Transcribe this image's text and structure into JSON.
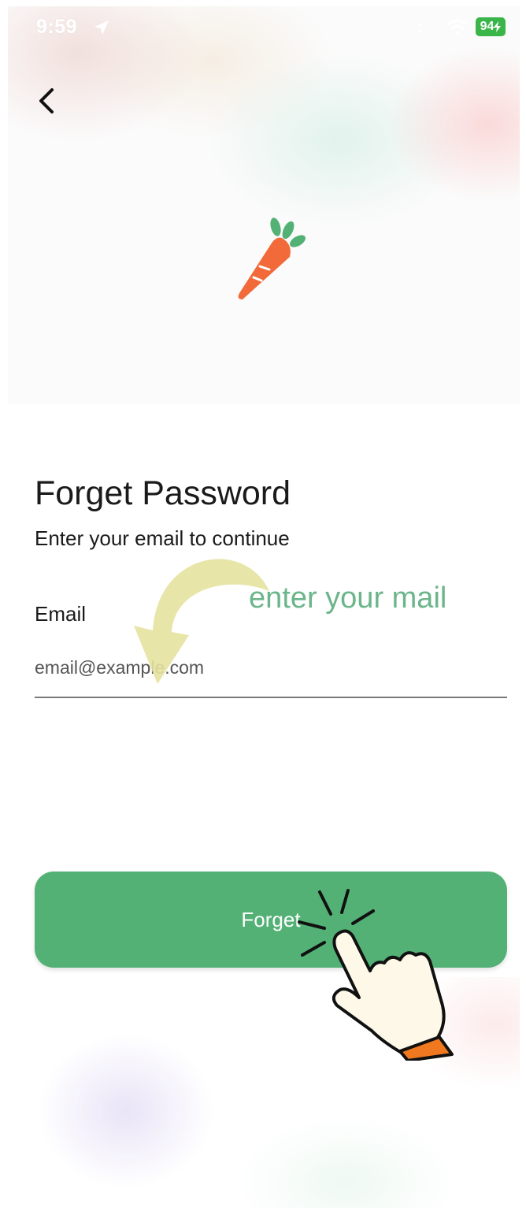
{
  "status_bar": {
    "time": "9:59",
    "battery": "94"
  },
  "header": {
    "back_icon": "chevron-left-icon",
    "logo_icon": "carrot-icon"
  },
  "form": {
    "title": "Forget Password",
    "subtitle": "Enter your email to continue",
    "email_label": "Email",
    "email_placeholder": "email@example.com",
    "submit_label": "Forget"
  },
  "annotation": {
    "text": "enter your mail",
    "arrow_icon": "curved-arrow-icon",
    "pointer_icon": "hand-pointer-icon"
  },
  "colors": {
    "accent": "#53b175",
    "carrot": "#f26a3a",
    "carrot_leaves": "#53b175",
    "annotation_text": "#6bb58a",
    "arrow": "#e6e2a0"
  }
}
